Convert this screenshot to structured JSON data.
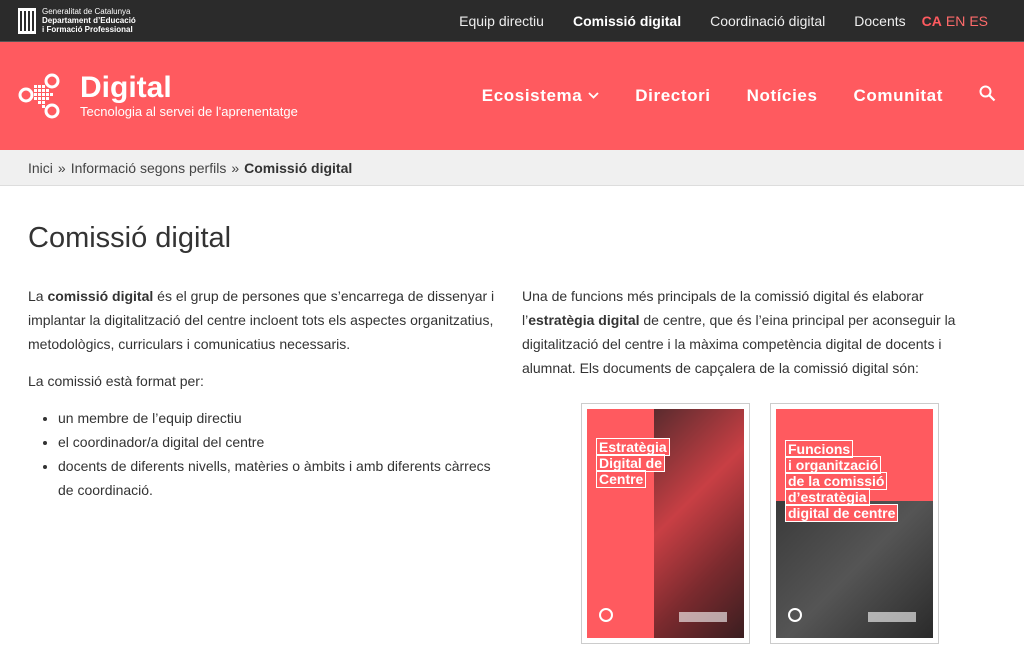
{
  "gencat": {
    "line1": "Generalitat de Catalunya",
    "line2": "Departament d’Educació",
    "line3": "i Formació Professional"
  },
  "topnav": {
    "items": [
      "Equip directiu",
      "Comissió digital",
      "Coordinació digital",
      "Docents"
    ],
    "active": "Comissió digital"
  },
  "langs": {
    "ca": "CA",
    "en": "EN",
    "es": "ES"
  },
  "brand": {
    "title": "Digital",
    "subtitle": "Tecnologia al servei de l'aprenentatge"
  },
  "mainnav": {
    "ecosistema": "Ecosistema",
    "directori": "Directori",
    "noticies": "Notícies",
    "comunitat": "Comunitat"
  },
  "breadcrumb": {
    "home": "Inici",
    "section": "Informació segons perfils",
    "current": "Comissió digital",
    "sep": "»"
  },
  "main": {
    "title": "Comissió digital",
    "left": {
      "p1_a": "La ",
      "p1_b": "comissió digital",
      "p1_c": " és el grup de persones que s’encarrega de dissenyar i implantar la digitalització del centre incloent tots els aspectes organitzatius, metodològics, curriculars i comunicatius necessaris.",
      "p2": "La comissió està format per:",
      "list": [
        "un membre de l’equip directiu",
        "el coordinador/a digital del centre",
        "docents de diferents nivells, matèries o àmbits i amb diferents càrrecs de coordinació."
      ]
    },
    "right": {
      "p1_a": "Una de funcions més principals de la comissió digital és elaborar l’",
      "p1_b": "estratègia digital",
      "p1_c": " de centre, que és l’eina principal per aconseguir la digitalització del centre i la màxima competència digital de docents i alumnat. Els documents de capçalera de la comissió digital són:"
    },
    "covers": [
      {
        "lines": [
          "Estratègia",
          "Digital de",
          "Centre"
        ]
      },
      {
        "lines": [
          "Funcions",
          "i organització",
          "de la comissió",
          "d’estratègia",
          "digital de centre"
        ]
      }
    ]
  },
  "colors": {
    "brand_red": "#ff5a5f",
    "topbar": "#2b2b2b"
  }
}
